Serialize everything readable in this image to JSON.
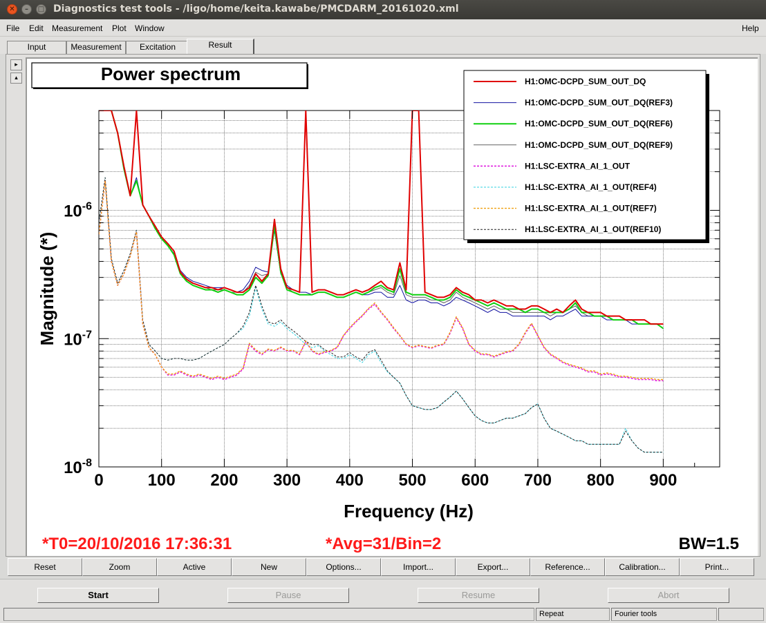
{
  "window": {
    "title": "Diagnostics test tools - /ligo/home/keita.kawabe/PMCDARM_20161020.xml"
  },
  "menu": {
    "file": "File",
    "edit": "Edit",
    "measurement": "Measurement",
    "plot": "Plot",
    "window": "Window",
    "help": "Help"
  },
  "tabs": [
    {
      "label": "Input"
    },
    {
      "label": "Measurement"
    },
    {
      "label": "Excitation"
    },
    {
      "label": "Result"
    }
  ],
  "plot": {
    "title": "Power spectrum",
    "t0": "*T0=20/10/2016 17:36:31",
    "avg": "*Avg=31/Bin=2",
    "bw": "BW=1.5"
  },
  "chart_data": {
    "type": "line",
    "title": "Power spectrum",
    "xlabel": "Frequency (Hz)",
    "ylabel": "Magnitude (*)",
    "xlim": [
      0,
      990
    ],
    "ylim": [
      1e-08,
      6e-06
    ],
    "yscale": "log",
    "grid": true,
    "legend_position": "top-right",
    "x_ticks": [
      "0",
      "100",
      "200",
      "300",
      "400",
      "500",
      "600",
      "700",
      "800",
      "900"
    ],
    "y_ticks": [
      {
        "base": "10",
        "exp": "-8",
        "value": 1e-08
      },
      {
        "base": "10",
        "exp": "-7",
        "value": 1e-07
      },
      {
        "base": "10",
        "exp": "-6",
        "value": 1e-06
      }
    ],
    "x": [
      0,
      10,
      20,
      30,
      40,
      50,
      60,
      70,
      80,
      90,
      100,
      110,
      120,
      130,
      140,
      150,
      160,
      170,
      180,
      190,
      200,
      210,
      220,
      230,
      240,
      250,
      260,
      270,
      280,
      290,
      300,
      310,
      320,
      330,
      340,
      350,
      360,
      370,
      380,
      390,
      400,
      410,
      420,
      430,
      440,
      450,
      460,
      470,
      480,
      490,
      500,
      510,
      520,
      530,
      540,
      550,
      560,
      570,
      580,
      590,
      600,
      610,
      620,
      630,
      640,
      650,
      660,
      670,
      680,
      690,
      700,
      710,
      720,
      730,
      740,
      750,
      760,
      770,
      780,
      790,
      800,
      810,
      820,
      830,
      840,
      850,
      860,
      870,
      880,
      890,
      900
    ],
    "series": [
      {
        "name": "H1:OMC-DCPD_SUM_OUT_DQ",
        "color": "#e00000",
        "width": 2,
        "dash": "",
        "values": [
          6e-06,
          6e-06,
          6e-06,
          4e-06,
          2.2e-06,
          1.3e-06,
          6e-06,
          1.1e-06,
          9e-07,
          7.5e-07,
          6.2e-07,
          5.5e-07,
          4.8e-07,
          3.3e-07,
          2.9e-07,
          2.7e-07,
          2.6e-07,
          2.5e-07,
          2.5e-07,
          2.4e-07,
          2.5e-07,
          2.4e-07,
          2.3e-07,
          2.3e-07,
          2.5e-07,
          3.2e-07,
          2.8e-07,
          3.2e-07,
          8.5e-07,
          3.5e-07,
          2.5e-07,
          2.4e-07,
          2.3e-07,
          6e-06,
          2.3e-07,
          2.4e-07,
          2.4e-07,
          2.3e-07,
          2.2e-07,
          2.2e-07,
          2.3e-07,
          2.4e-07,
          2.3e-07,
          2.4e-07,
          2.6e-07,
          2.8e-07,
          2.5e-07,
          2.4e-07,
          3.9e-07,
          2.4e-07,
          6e-06,
          6e-06,
          2.3e-07,
          2.2e-07,
          2.1e-07,
          2.1e-07,
          2.2e-07,
          2.5e-07,
          2.3e-07,
          2.2e-07,
          2e-07,
          2e-07,
          1.9e-07,
          2e-07,
          1.9e-07,
          1.8e-07,
          1.8e-07,
          1.7e-07,
          1.7e-07,
          1.8e-07,
          1.8e-07,
          1.7e-07,
          1.6e-07,
          1.7e-07,
          1.6e-07,
          1.8e-07,
          2e-07,
          1.7e-07,
          1.6e-07,
          1.6e-07,
          1.6e-07,
          1.5e-07,
          1.5e-07,
          1.5e-07,
          1.4e-07,
          1.4e-07,
          1.4e-07,
          1.4e-07,
          1.3e-07,
          1.3e-07,
          1.3e-07
        ]
      },
      {
        "name": "H1:OMC-DCPD_SUM_OUT_DQ(REF3)",
        "color": "#1010a0",
        "width": 1,
        "dash": "",
        "values": [
          6e-06,
          6e-06,
          6e-06,
          4e-06,
          2.1e-06,
          1.3e-06,
          1.8e-06,
          1.1e-06,
          9e-07,
          7.5e-07,
          6e-07,
          5.3e-07,
          4.6e-07,
          3.4e-07,
          3e-07,
          2.8e-07,
          2.7e-07,
          2.6e-07,
          2.5e-07,
          2.5e-07,
          2.5e-07,
          2.4e-07,
          2.3e-07,
          2.4e-07,
          2.8e-07,
          3.6e-07,
          3.4e-07,
          3.3e-07,
          7e-07,
          3.2e-07,
          2.6e-07,
          2.4e-07,
          2.3e-07,
          2.3e-07,
          2.2e-07,
          2.3e-07,
          2.3e-07,
          2.2e-07,
          2.1e-07,
          2.1e-07,
          2.2e-07,
          2.3e-07,
          2.2e-07,
          2.2e-07,
          2.3e-07,
          2.3e-07,
          2.1e-07,
          2.1e-07,
          2.6e-07,
          2e-07,
          1.9e-07,
          2e-07,
          2e-07,
          1.9e-07,
          1.9e-07,
          1.8e-07,
          1.9e-07,
          2.1e-07,
          2e-07,
          1.9e-07,
          1.8e-07,
          1.7e-07,
          1.6e-07,
          1.7e-07,
          1.6e-07,
          1.6e-07,
          1.5e-07,
          1.5e-07,
          1.5e-07,
          1.5e-07,
          1.5e-07,
          1.5e-07,
          1.4e-07,
          1.5e-07,
          1.5e-07,
          1.6e-07,
          1.7e-07,
          1.5e-07,
          1.5e-07,
          1.5e-07,
          1.5e-07,
          1.4e-07,
          1.4e-07,
          1.4e-07,
          1.4e-07,
          1.3e-07,
          1.3e-07,
          1.3e-07,
          1.3e-07,
          1.3e-07,
          1.2e-07
        ]
      },
      {
        "name": "H1:OMC-DCPD_SUM_OUT_DQ(REF6)",
        "color": "#10d010",
        "width": 2,
        "dash": "",
        "values": [
          6e-06,
          6e-06,
          6e-06,
          4e-06,
          2.1e-06,
          1.3e-06,
          1.7e-06,
          1.1e-06,
          9e-07,
          7.2e-07,
          6e-07,
          5.3e-07,
          4.5e-07,
          3.2e-07,
          2.8e-07,
          2.6e-07,
          2.5e-07,
          2.4e-07,
          2.4e-07,
          2.3e-07,
          2.4e-07,
          2.3e-07,
          2.2e-07,
          2.2e-07,
          2.4e-07,
          3e-07,
          2.7e-07,
          3.1e-07,
          7.5e-07,
          3.3e-07,
          2.4e-07,
          2.3e-07,
          2.2e-07,
          2.2e-07,
          2.2e-07,
          2.3e-07,
          2.3e-07,
          2.2e-07,
          2.1e-07,
          2.1e-07,
          2.2e-07,
          2.3e-07,
          2.2e-07,
          2.3e-07,
          2.5e-07,
          2.6e-07,
          2.4e-07,
          2.3e-07,
          3.5e-07,
          2.3e-07,
          2.2e-07,
          2.2e-07,
          2.2e-07,
          2.1e-07,
          2e-07,
          2e-07,
          2.1e-07,
          2.4e-07,
          2.2e-07,
          2.1e-07,
          2e-07,
          1.9e-07,
          1.8e-07,
          1.9e-07,
          1.8e-07,
          1.7e-07,
          1.7e-07,
          1.7e-07,
          1.6e-07,
          1.7e-07,
          1.7e-07,
          1.6e-07,
          1.6e-07,
          1.6e-07,
          1.6e-07,
          1.7e-07,
          1.9e-07,
          1.6e-07,
          1.6e-07,
          1.5e-07,
          1.5e-07,
          1.5e-07,
          1.4e-07,
          1.4e-07,
          1.4e-07,
          1.4e-07,
          1.3e-07,
          1.3e-07,
          1.3e-07,
          1.3e-07,
          1.2e-07
        ]
      },
      {
        "name": "H1:OMC-DCPD_SUM_OUT_DQ(REF9)",
        "color": "#606060",
        "width": 1,
        "dash": "",
        "values": [
          6e-06,
          6e-06,
          6e-06,
          4e-06,
          2.1e-06,
          1.3e-06,
          1.7e-06,
          1.1e-06,
          9e-07,
          7.3e-07,
          6e-07,
          5.3e-07,
          4.5e-07,
          3.3e-07,
          2.9e-07,
          2.7e-07,
          2.6e-07,
          2.5e-07,
          2.4e-07,
          2.4e-07,
          2.4e-07,
          2.3e-07,
          2.3e-07,
          2.3e-07,
          2.6e-07,
          3.3e-07,
          3.1e-07,
          3.2e-07,
          7.8e-07,
          3.3e-07,
          2.5e-07,
          2.3e-07,
          2.2e-07,
          2.2e-07,
          2.2e-07,
          2.3e-07,
          2.3e-07,
          2.2e-07,
          2.1e-07,
          2.1e-07,
          2.2e-07,
          2.3e-07,
          2.2e-07,
          2.3e-07,
          2.4e-07,
          2.5e-07,
          2.3e-07,
          2.2e-07,
          3.1e-07,
          2.2e-07,
          2.1e-07,
          2.1e-07,
          2.1e-07,
          2e-07,
          2e-07,
          1.9e-07,
          2e-07,
          2.3e-07,
          2.1e-07,
          2e-07,
          1.9e-07,
          1.8e-07,
          1.7e-07,
          1.8e-07,
          1.7e-07,
          1.7e-07,
          1.6e-07,
          1.6e-07,
          1.6e-07,
          1.6e-07,
          1.6e-07,
          1.6e-07,
          1.5e-07,
          1.6e-07,
          1.6e-07,
          1.7e-07,
          1.8e-07,
          1.6e-07,
          1.5e-07,
          1.5e-07,
          1.5e-07,
          1.5e-07,
          1.4e-07,
          1.4e-07,
          1.4e-07,
          1.4e-07,
          1.3e-07,
          1.3e-07,
          1.3e-07,
          1.3e-07,
          1.2e-07
        ]
      },
      {
        "name": "H1:LSC-EXTRA_AI_1_OUT",
        "color": "#e020e0",
        "width": 1.6,
        "dash": "3,2",
        "values": [
          6.5e-07,
          1.7e-06,
          4e-07,
          2.6e-07,
          3.2e-07,
          4.4e-07,
          6.8e-07,
          1.3e-07,
          8.5e-08,
          7.5e-08,
          6e-08,
          5.2e-08,
          5.2e-08,
          5.5e-08,
          5.2e-08,
          5e-08,
          5.2e-08,
          5e-08,
          4.8e-08,
          5e-08,
          4.8e-08,
          5e-08,
          5.2e-08,
          5.8e-08,
          9e-08,
          8e-08,
          7.5e-08,
          8.2e-08,
          8e-08,
          8.5e-08,
          8e-08,
          8e-08,
          7.5e-08,
          9.5e-08,
          8e-08,
          7.5e-08,
          7.8e-08,
          8e-08,
          8.5e-08,
          1.05e-07,
          1.2e-07,
          1.35e-07,
          1.5e-07,
          1.7e-07,
          1.85e-07,
          1.6e-07,
          1.4e-07,
          1.2e-07,
          1.05e-07,
          9e-08,
          8.5e-08,
          8.8e-08,
          8.6e-08,
          8.4e-08,
          8.8e-08,
          9e-08,
          1.1e-07,
          1.45e-07,
          1.2e-07,
          9e-08,
          8e-08,
          7.5e-08,
          7.5e-08,
          7.2e-08,
          7.5e-08,
          7.8e-08,
          8e-08,
          9e-08,
          1.1e-07,
          1.3e-07,
          1.05e-07,
          8.5e-08,
          7.5e-08,
          7e-08,
          6.5e-08,
          6.2e-08,
          6e-08,
          5.8e-08,
          5.5e-08,
          5.5e-08,
          5.2e-08,
          5.3e-08,
          5.2e-08,
          5e-08,
          5e-08,
          4.9e-08,
          4.8e-08,
          4.8e-08,
          4.8e-08,
          4.7e-08,
          4.7e-08
        ]
      },
      {
        "name": "H1:LSC-EXTRA_AI_1_OUT(REF4)",
        "color": "#30d0e0",
        "width": 1,
        "dash": "3,2",
        "values": [
          8e-07,
          1.8e-06,
          4.2e-07,
          2.7e-07,
          3.4e-07,
          4.6e-07,
          7e-07,
          1.4e-07,
          9e-08,
          8e-08,
          7e-08,
          6.8e-08,
          7e-08,
          7e-08,
          6.8e-08,
          6.8e-08,
          7e-08,
          7.5e-08,
          8e-08,
          8.5e-08,
          9e-08,
          1e-07,
          1.1e-07,
          1.2e-07,
          1.5e-07,
          2.5e-07,
          1.7e-07,
          1.3e-07,
          1.25e-07,
          1.35e-07,
          1.2e-07,
          1.1e-07,
          1e-07,
          9e-08,
          8.5e-08,
          8.8e-08,
          8e-08,
          7.5e-08,
          7e-08,
          7e-08,
          7.5e-08,
          7e-08,
          6.5e-08,
          7.5e-08,
          8e-08,
          6.5e-08,
          5.5e-08,
          5e-08,
          4.5e-08,
          3.6e-08,
          3e-08,
          2.9e-08,
          2.8e-08,
          2.8e-08,
          2.9e-08,
          3.2e-08,
          3.5e-08,
          3.9e-08,
          3.4e-08,
          2.9e-08,
          2.5e-08,
          2.3e-08,
          2.2e-08,
          2.2e-08,
          2.3e-08,
          2.4e-08,
          2.4e-08,
          2.5e-08,
          2.6e-08,
          2.9e-08,
          3.1e-08,
          2.4e-08,
          2e-08,
          1.9e-08,
          1.8e-08,
          1.7e-08,
          1.6e-08,
          1.6e-08,
          1.5e-08,
          1.5e-08,
          1.5e-08,
          1.5e-08,
          1.5e-08,
          1.5e-08,
          2e-08,
          1.6e-08,
          1.4e-08,
          1.3e-08,
          1.3e-08,
          1.3e-08,
          1.3e-08
        ]
      },
      {
        "name": "H1:LSC-EXTRA_AI_1_OUT(REF7)",
        "color": "#f0a010",
        "width": 1.4,
        "dash": "3,2",
        "values": [
          6.5e-07,
          1.7e-06,
          4e-07,
          2.6e-07,
          3.2e-07,
          4.4e-07,
          6.8e-07,
          1.3e-07,
          8.5e-08,
          7.5e-08,
          6e-08,
          5.3e-08,
          5.3e-08,
          5.6e-08,
          5.3e-08,
          5.1e-08,
          5.3e-08,
          5.1e-08,
          4.9e-08,
          5.1e-08,
          4.9e-08,
          5.1e-08,
          5.3e-08,
          5.9e-08,
          9.2e-08,
          8.2e-08,
          7.6e-08,
          8.3e-08,
          8.1e-08,
          8.6e-08,
          8.1e-08,
          8.1e-08,
          7.6e-08,
          9.6e-08,
          8.1e-08,
          7.6e-08,
          7.9e-08,
          8.1e-08,
          8.6e-08,
          1.06e-07,
          1.22e-07,
          1.37e-07,
          1.52e-07,
          1.72e-07,
          1.9e-07,
          1.62e-07,
          1.42e-07,
          1.22e-07,
          1.06e-07,
          9.1e-08,
          8.6e-08,
          8.9e-08,
          8.7e-08,
          8.5e-08,
          8.9e-08,
          9.1e-08,
          1.12e-07,
          1.48e-07,
          1.22e-07,
          9.1e-08,
          8.1e-08,
          7.6e-08,
          7.6e-08,
          7.3e-08,
          7.6e-08,
          7.9e-08,
          8.1e-08,
          9.1e-08,
          1.12e-07,
          1.32e-07,
          1.06e-07,
          8.6e-08,
          7.6e-08,
          7.1e-08,
          6.6e-08,
          6.3e-08,
          6.1e-08,
          5.9e-08,
          5.6e-08,
          5.6e-08,
          5.3e-08,
          5.4e-08,
          5.3e-08,
          5.1e-08,
          5.1e-08,
          5e-08,
          4.9e-08,
          4.9e-08,
          4.9e-08,
          4.8e-08,
          4.8e-08
        ]
      },
      {
        "name": "H1:LSC-EXTRA_AI_1_OUT(REF10)",
        "color": "#202020",
        "width": 1,
        "dash": "3,2",
        "values": [
          8e-07,
          1.8e-06,
          4.2e-07,
          2.7e-07,
          3.4e-07,
          4.6e-07,
          7e-07,
          1.4e-07,
          9e-08,
          8e-08,
          7e-08,
          6.8e-08,
          7e-08,
          7e-08,
          6.8e-08,
          6.8e-08,
          7e-08,
          7.5e-08,
          8e-08,
          8.5e-08,
          9e-08,
          1e-07,
          1.1e-07,
          1.25e-07,
          1.6e-07,
          2.6e-07,
          1.8e-07,
          1.35e-07,
          1.3e-07,
          1.4e-07,
          1.25e-07,
          1.15e-07,
          1.05e-07,
          9.5e-08,
          9e-08,
          9e-08,
          8.2e-08,
          7.8e-08,
          7.2e-08,
          7.2e-08,
          7.8e-08,
          7.2e-08,
          6.8e-08,
          7.8e-08,
          8.2e-08,
          6.8e-08,
          5.6e-08,
          5e-08,
          4.5e-08,
          3.6e-08,
          3e-08,
          2.9e-08,
          2.8e-08,
          2.8e-08,
          2.9e-08,
          3.2e-08,
          3.5e-08,
          3.9e-08,
          3.4e-08,
          2.9e-08,
          2.5e-08,
          2.3e-08,
          2.2e-08,
          2.2e-08,
          2.3e-08,
          2.4e-08,
          2.4e-08,
          2.5e-08,
          2.6e-08,
          2.9e-08,
          3.1e-08,
          2.4e-08,
          2e-08,
          1.9e-08,
          1.8e-08,
          1.7e-08,
          1.6e-08,
          1.6e-08,
          1.5e-08,
          1.5e-08,
          1.5e-08,
          1.5e-08,
          1.5e-08,
          1.5e-08,
          1.9e-08,
          1.6e-08,
          1.4e-08,
          1.3e-08,
          1.3e-08,
          1.3e-08,
          1.3e-08
        ]
      }
    ]
  },
  "toolbar": {
    "reset": "Reset",
    "zoom": "Zoom",
    "active": "Active",
    "new": "New",
    "options": "Options...",
    "import": "Import...",
    "export": "Export...",
    "reference": "Reference...",
    "calibration": "Calibration...",
    "print": "Print..."
  },
  "controls": {
    "start": "Start",
    "pause": "Pause",
    "resume": "Resume",
    "abort": "Abort"
  },
  "status": {
    "repeat": "Repeat",
    "tools": "Fourier tools"
  }
}
